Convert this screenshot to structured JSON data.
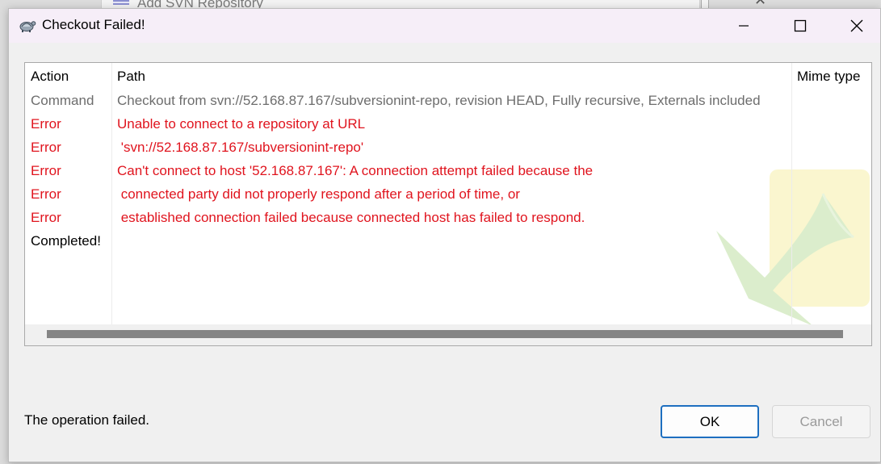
{
  "background_window": {
    "title": "Add SVN Repository"
  },
  "dialog": {
    "title": "Checkout Failed!",
    "controls": {
      "minimize_icon": "minimize-icon",
      "maximize_icon": "maximize-icon",
      "close_icon": "close-icon"
    }
  },
  "log": {
    "columns": [
      "Action",
      "Path",
      "Mime type"
    ],
    "rows": [
      {
        "action": "Command",
        "path": "Checkout from svn://52.168.87.167/subversionint-repo, revision HEAD, Fully recursive, Externals included",
        "kind": "command"
      },
      {
        "action": "Error",
        "path": "Unable to connect to a repository at URL",
        "kind": "error"
      },
      {
        "action": "Error",
        "path": " 'svn://52.168.87.167/subversionint-repo'",
        "kind": "error"
      },
      {
        "action": "Error",
        "path": "Can't connect to host '52.168.87.167': A connection attempt failed because the",
        "kind": "error"
      },
      {
        "action": "Error",
        "path": " connected party did not properly respond after a period of time, or",
        "kind": "error"
      },
      {
        "action": "Error",
        "path": " established connection failed because connected host has failed to respond.",
        "kind": "error"
      },
      {
        "action": "Completed!",
        "path": "",
        "kind": "done"
      }
    ]
  },
  "status_text": "The operation failed.",
  "buttons": {
    "ok": "OK",
    "cancel": "Cancel"
  },
  "colors": {
    "error": "#e0141e",
    "command": "#6d6d6d",
    "accent": "#1e6fc0"
  }
}
